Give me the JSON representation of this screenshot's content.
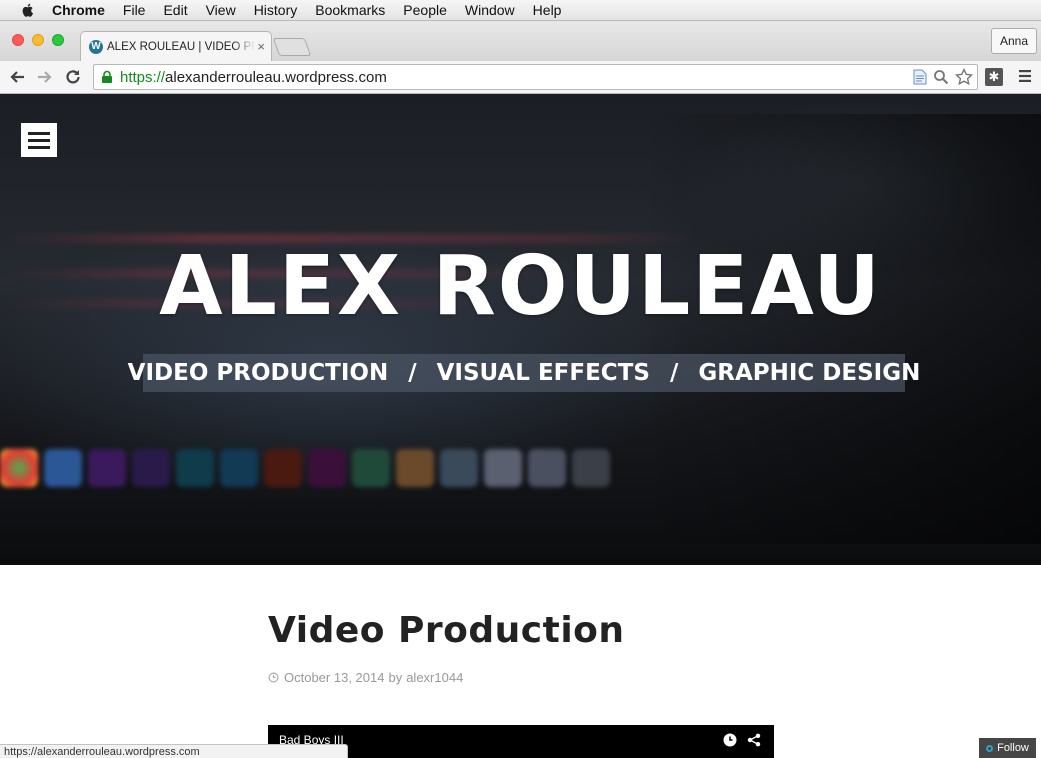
{
  "menubar": {
    "app": "Chrome",
    "items": [
      "File",
      "Edit",
      "View",
      "History",
      "Bookmarks",
      "People",
      "Window",
      "Help"
    ]
  },
  "browser": {
    "tab_title": "ALEX ROULEAU | VIDEO PRODUCTION",
    "tab_close": "×",
    "profile": "Anna",
    "url_scheme": "https://",
    "url_host": "alexanderrouleau.wordpress.com",
    "status_url": "https://alexanderrouleau.wordpress.com"
  },
  "hero": {
    "title": "ALEX ROULEAU",
    "taglines": [
      "VIDEO PRODUCTION",
      "VISUAL EFFECTS",
      "GRAPHIC DESIGN"
    ],
    "separator": "/"
  },
  "post": {
    "title": "Video Production",
    "date": "October 13, 2014",
    "by": "by",
    "author": "alexr1044",
    "video_title": "Bad Boys III"
  },
  "follow": {
    "label": "Follow"
  },
  "colors": {
    "url_green": "#138a1e",
    "wordpress_blue": "#21759b",
    "follow_bg": "#464646"
  }
}
